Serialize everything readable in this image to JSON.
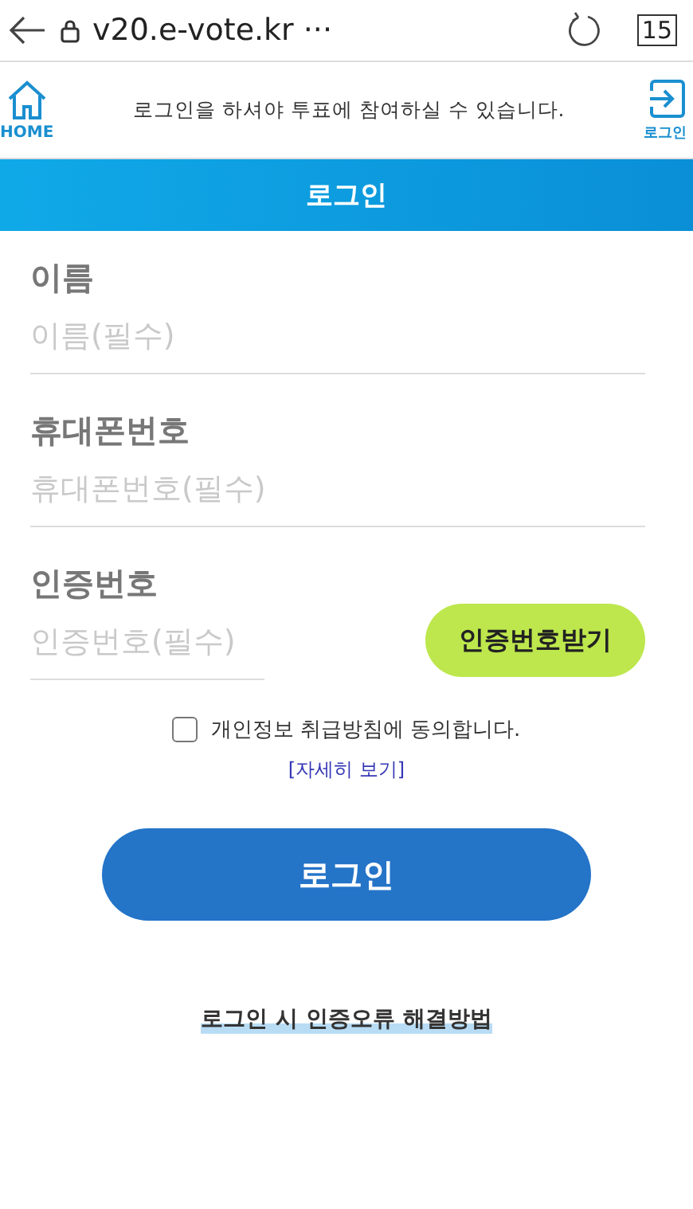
{
  "browser": {
    "url": "v20.e-vote.kr ···",
    "tab_count": "15"
  },
  "header": {
    "home_label": "HOME",
    "notice": "로그인을 하셔야 투표에 참여하실 수 있습니다.",
    "login_label": "로그인"
  },
  "title": "로그인",
  "fields": [
    {
      "kind": "text",
      "label": "이름",
      "placeholder": "이름(필수)"
    },
    {
      "kind": "text",
      "label": "휴대폰번호",
      "placeholder": "휴대폰번호(필수)"
    },
    {
      "kind": "code",
      "label": "인증번호",
      "placeholder": "인증번호(필수)",
      "button": "인증번호받기"
    }
  ],
  "consent": {
    "label": "개인정보 취급방침에 동의합니다.",
    "checked": false,
    "link": "[자세히 보기]"
  },
  "login_button": "로그인",
  "help_link": "로그인 시 인증오류 해결방법"
}
